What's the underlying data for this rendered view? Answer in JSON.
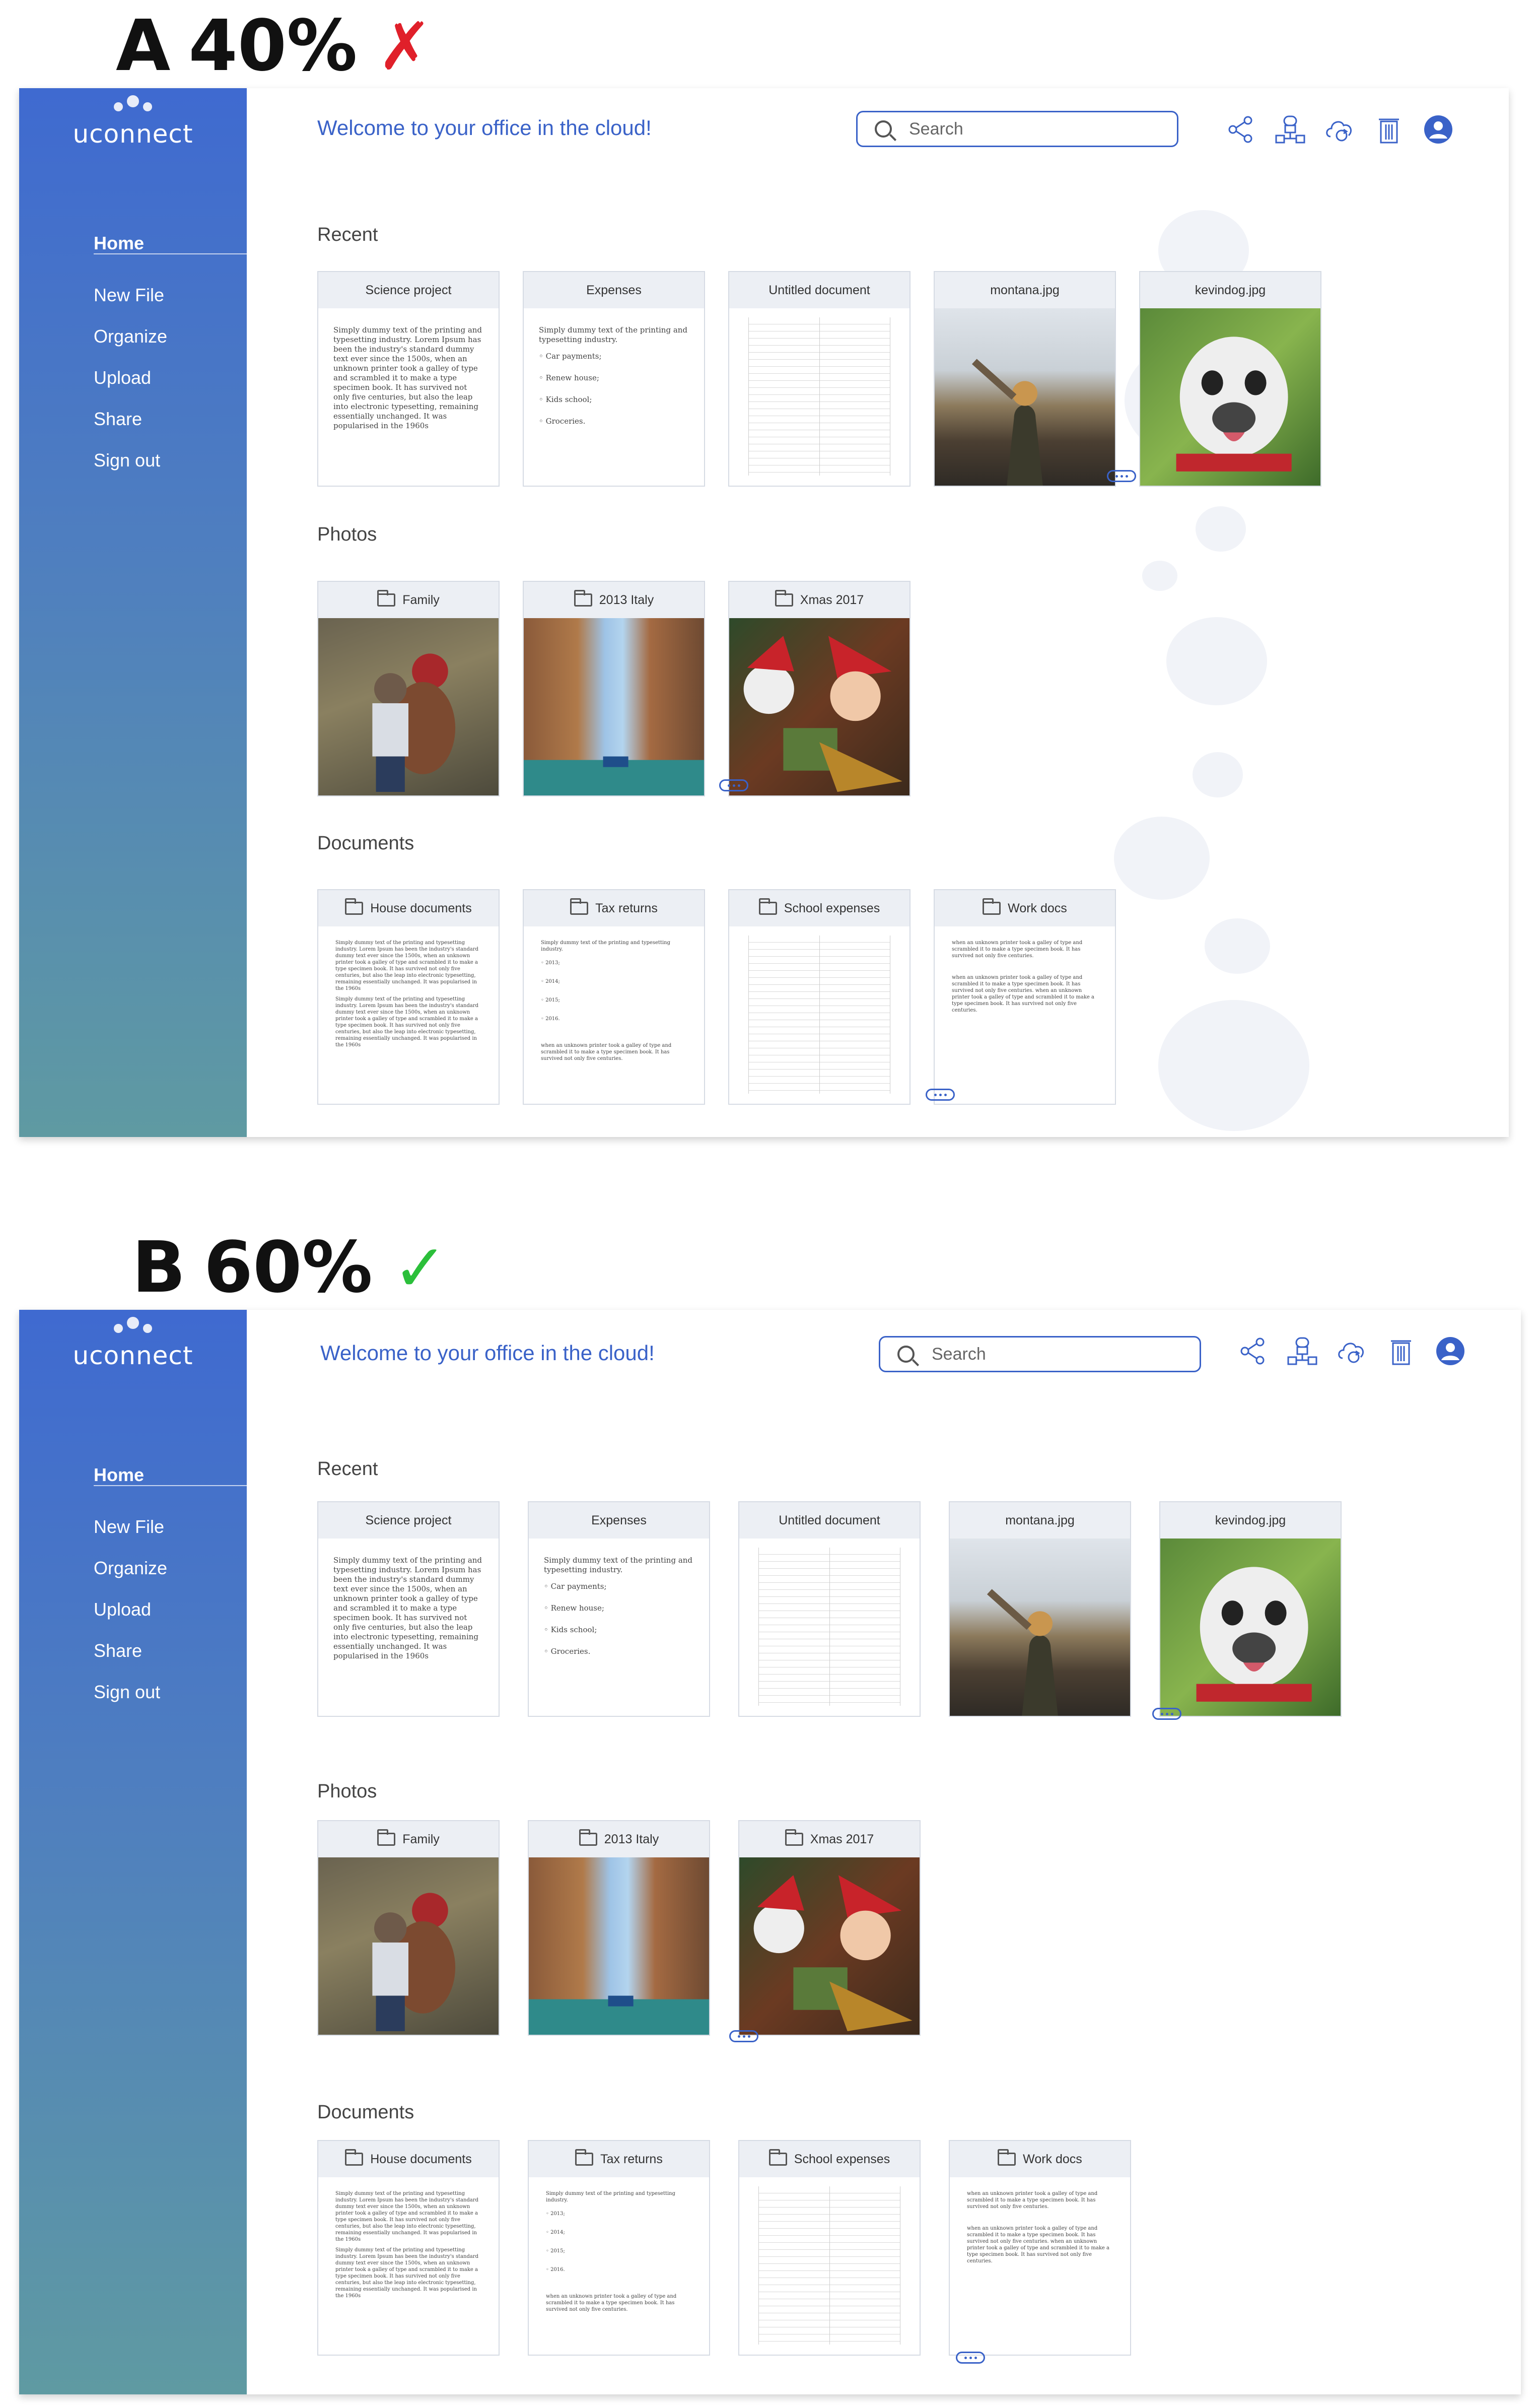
{
  "variants": [
    {
      "letter": "A",
      "percent": "40%",
      "verdict": "✗"
    },
    {
      "letter": "B",
      "percent": "60%",
      "verdict": "✓"
    }
  ],
  "app": {
    "logo": "uconnect",
    "welcome": "Welcome to your office in the cloud!",
    "search_placeholder": "Search"
  },
  "sidebar": {
    "items": [
      {
        "label": "Home"
      },
      {
        "label": "New File"
      },
      {
        "label": "Organize"
      },
      {
        "label": "Upload"
      },
      {
        "label": "Share"
      },
      {
        "label": "Sign out"
      }
    ]
  },
  "toolbar": {
    "icons": [
      "share-icon",
      "network-icon",
      "cloud-sync-icon",
      "trash-icon",
      "user-icon"
    ]
  },
  "sections": {
    "recent": "Recent",
    "photos": "Photos",
    "documents": "Documents"
  },
  "recent": [
    {
      "title": "Science project",
      "text": "Simply dummy text of the printing and typesetting industry. Lorem Ipsum has been the industry's standard dummy text ever since the 1500s, when an unknown printer took a galley of type and scrambled it to make a type specimen book. It has survived not only five centuries, but also the leap into electronic typesetting, remaining essentially unchanged. It was popularised in the 1960s"
    },
    {
      "title": "Expenses",
      "intro": "Simply dummy text of the printing and typesetting industry.",
      "items": [
        "Car payments;",
        "Renew house;",
        "Kids school;",
        "Groceries."
      ]
    },
    {
      "title": "Untitled document"
    },
    {
      "title": "montana.jpg"
    },
    {
      "title": "kevindog.jpg"
    }
  ],
  "photos": [
    {
      "title": "Family"
    },
    {
      "title": "2013 Italy"
    },
    {
      "title": "Xmas 2017"
    }
  ],
  "documents": [
    {
      "title": "House documents",
      "text": "Simply dummy text of the printing and typesetting industry. Lorem Ipsum has been the industry's standard dummy text ever since the 1500s, when an unknown printer took a galley of type and scrambled it to make a type specimen book. It has survived not only five centuries, but also the leap into electronic typesetting, remaining essentially unchanged. It was popularised in the 1960s",
      "text2": "Simply dummy text of the printing and typesetting industry. Lorem Ipsum has been the industry's standard dummy text ever since the 1500s, when an unknown printer took a galley of type and scrambled it to make a type specimen book. It has survived not only five centuries, but also the leap into electronic typesetting, remaining essentially unchanged. It was popularised in the 1960s"
    },
    {
      "title": "Tax returns",
      "intro": "Simply dummy text of the printing and typesetting industry.",
      "years": [
        "2013;",
        "2014;",
        "2015;",
        "2016."
      ],
      "outro": "when an unknown printer took a galley of type and scrambled it to make a type specimen book. It has survived not only five centuries."
    },
    {
      "title": "School expenses"
    },
    {
      "title": "Work docs",
      "p1": "when an unknown printer took a galley of type and scrambled it to make a type specimen book. It has survived not only five centuries.",
      "p2": "when an unknown printer took a galley of type and scrambled it to make a type specimen book. It has survived not only five centuries. when an unknown printer took a galley of type and scrambled it to make a type specimen book. It has survived not only five centuries."
    }
  ],
  "colors": {
    "accent": "#3a62c8",
    "sidebar_top": "#3f6ad0",
    "sidebar_bottom": "#5f9aa2",
    "cross": "#e0202a",
    "check": "#2bbf3a"
  }
}
